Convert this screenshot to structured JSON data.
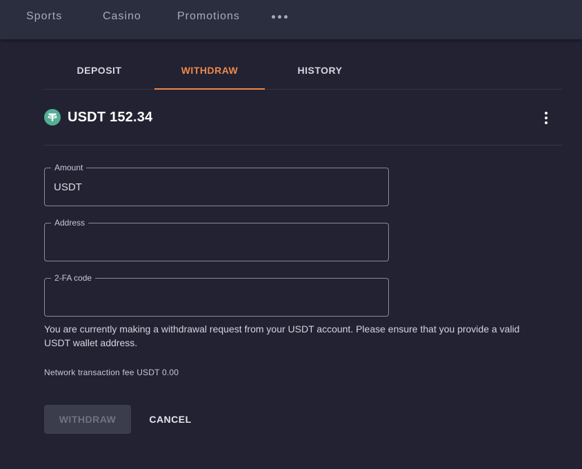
{
  "nav": {
    "items": [
      "Sports",
      "Casino",
      "Promotions"
    ],
    "more_icon": "more-horizontal-icon"
  },
  "tabs": [
    {
      "label": "DEPOSIT",
      "active": false
    },
    {
      "label": "WITHDRAW",
      "active": true
    },
    {
      "label": "HISTORY",
      "active": false
    }
  ],
  "balance": {
    "currency_icon": "tether-usdt-icon",
    "text": "USDT 152.34",
    "menu_icon": "more-vertical-icon"
  },
  "form": {
    "amount": {
      "label": "Amount",
      "placeholder": "USDT",
      "value": ""
    },
    "address": {
      "label": "Address",
      "placeholder": "",
      "value": ""
    },
    "twofa": {
      "label": "2-FA code",
      "placeholder": "",
      "value": ""
    }
  },
  "info_text": "You are currently making a withdrawal request from your USDT account. Please ensure that you provide a valid USDT wallet address.",
  "fee_text": "Network transaction fee USDT 0.00",
  "buttons": {
    "withdraw": "WITHDRAW",
    "cancel": "CANCEL"
  },
  "colors": {
    "background": "#222232",
    "nav_background": "#2b2e3f",
    "accent": "#f0894a",
    "usdt_green": "#53ae94",
    "disabled_button": "#3b3d4d"
  }
}
